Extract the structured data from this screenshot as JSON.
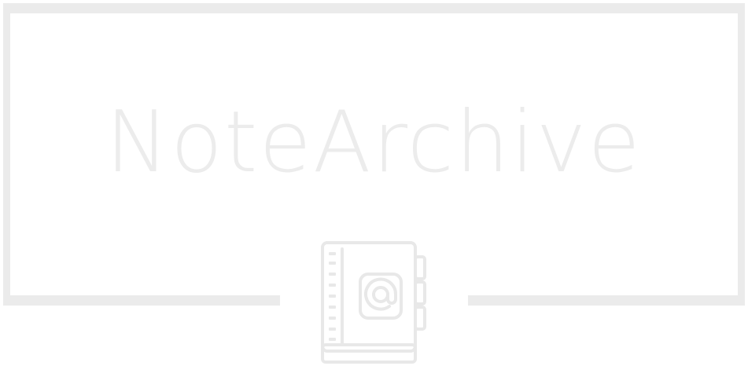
{
  "brand": {
    "name": "NoteArchive",
    "icon": "address-book-at-icon",
    "color": "#ebebeb"
  }
}
